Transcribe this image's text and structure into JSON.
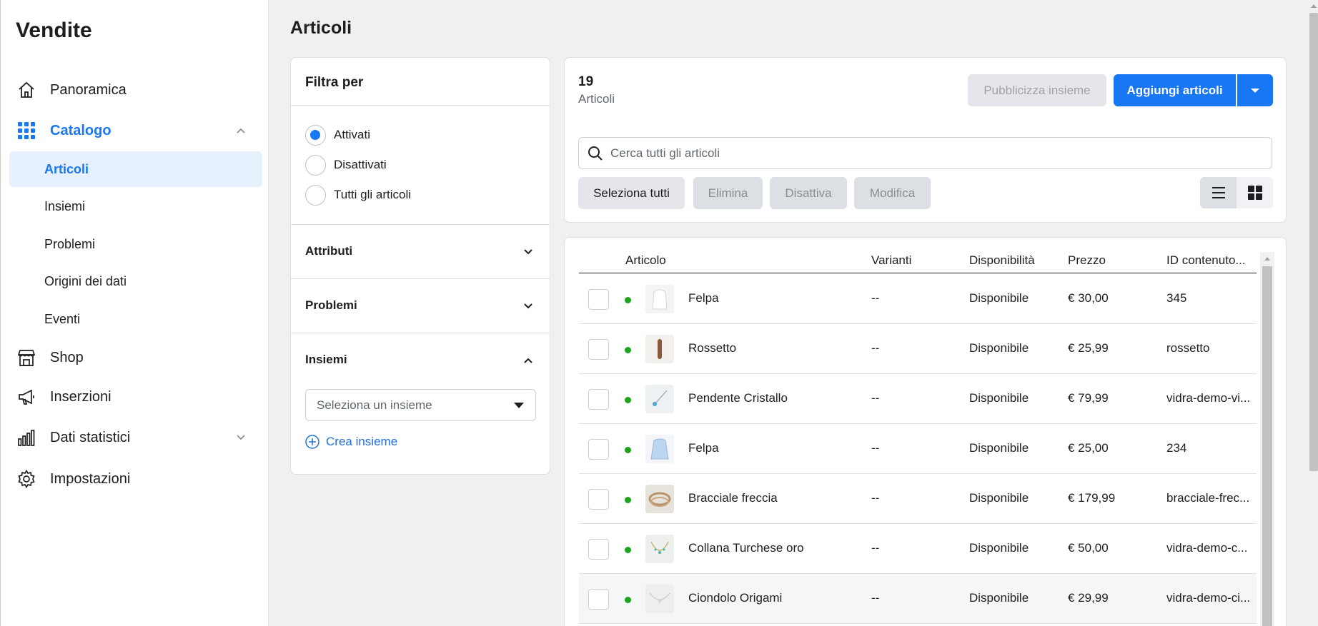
{
  "sidebar": {
    "title": "Vendite",
    "items": [
      {
        "label": "Panoramica",
        "icon": "home-icon"
      },
      {
        "label": "Catalogo",
        "icon": "grid-icon"
      },
      {
        "label": "Shop",
        "icon": "storefront-icon"
      },
      {
        "label": "Inserzioni",
        "icon": "megaphone-icon"
      },
      {
        "label": "Dati statistici",
        "icon": "bar-chart-icon"
      },
      {
        "label": "Impostazioni",
        "icon": "gear-icon"
      }
    ],
    "catalog_sub": [
      "Articoli",
      "Insiemi",
      "Problemi",
      "Origini dei dati",
      "Eventi"
    ]
  },
  "page": {
    "title": "Articoli"
  },
  "filter": {
    "title": "Filtra per",
    "status_options": [
      "Attivati",
      "Disattivati",
      "Tutti gli articoli"
    ],
    "selected_status": "Attivati",
    "sections": [
      "Attributi",
      "Problemi",
      "Insiemi"
    ],
    "set_select_placeholder": "Seleziona un insieme",
    "create_set": "Crea insieme"
  },
  "summary": {
    "count": "19",
    "count_label": "Articoli"
  },
  "toolbar": {
    "publish_together": "Pubblicizza insieme",
    "add_items": "Aggiungi articoli",
    "search_placeholder": "Cerca tutti gli articoli",
    "select_all": "Seleziona tutti",
    "delete": "Elimina",
    "deactivate": "Disattiva",
    "edit": "Modifica",
    "view_mode": "list"
  },
  "table": {
    "headers": [
      "Articolo",
      "Varianti",
      "Disponibilità",
      "Prezzo",
      "ID contenuto..."
    ],
    "rows": [
      {
        "name": "Felpa",
        "variants": "--",
        "availability": "Disponibile",
        "price": "€ 30,00",
        "id": "345",
        "status": "active"
      },
      {
        "name": "Rossetto",
        "variants": "--",
        "availability": "Disponibile",
        "price": "€ 25,99",
        "id": "rossetto",
        "status": "active"
      },
      {
        "name": "Pendente Cristallo",
        "variants": "--",
        "availability": "Disponibile",
        "price": "€ 79,99",
        "id": "vidra-demo-vi...",
        "status": "active"
      },
      {
        "name": "Felpa",
        "variants": "--",
        "availability": "Disponibile",
        "price": "€ 25,00",
        "id": "234",
        "status": "active"
      },
      {
        "name": "Bracciale freccia",
        "variants": "--",
        "availability": "Disponibile",
        "price": "€ 179,99",
        "id": "bracciale-frec...",
        "status": "active"
      },
      {
        "name": "Collana Turchese oro",
        "variants": "--",
        "availability": "Disponibile",
        "price": "€ 50,00",
        "id": "vidra-demo-c...",
        "status": "active"
      },
      {
        "name": "Ciondolo Origami",
        "variants": "--",
        "availability": "Disponibile",
        "price": "€ 29,99",
        "id": "vidra-demo-ci...",
        "status": "active"
      }
    ]
  },
  "colors": {
    "accent": "#1877f2",
    "active_dot": "#1ea31e",
    "selected_bg": "#e7f0fd"
  }
}
